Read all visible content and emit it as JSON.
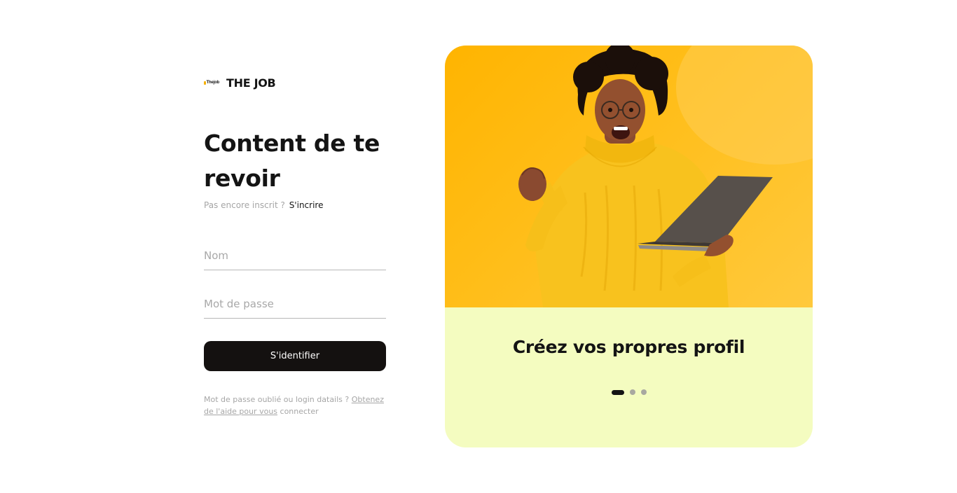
{
  "brand": {
    "logo_text": "Thejob",
    "name": "THE JOB"
  },
  "login": {
    "title": "Content de te revoir",
    "signup_prompt": "Pas encore inscrit ?",
    "signup_link": "S'incrire",
    "name_placeholder": "Nom",
    "password_placeholder": "Mot de passe",
    "submit_label": "S'identifier",
    "help_prefix": "Mot de passe oublié ou login datails ?",
    "help_link": "Obtenez de l'aide pour vous",
    "help_suffix": "connecter"
  },
  "carousel": {
    "caption": "Créez vos propres profil",
    "slide_count": 3,
    "active_slide": 1
  },
  "colors": {
    "primary_dark": "#141110",
    "hero_yellow": "#ffb400",
    "card_bg": "#f4fcc0",
    "muted_text": "#a6a6a6"
  }
}
